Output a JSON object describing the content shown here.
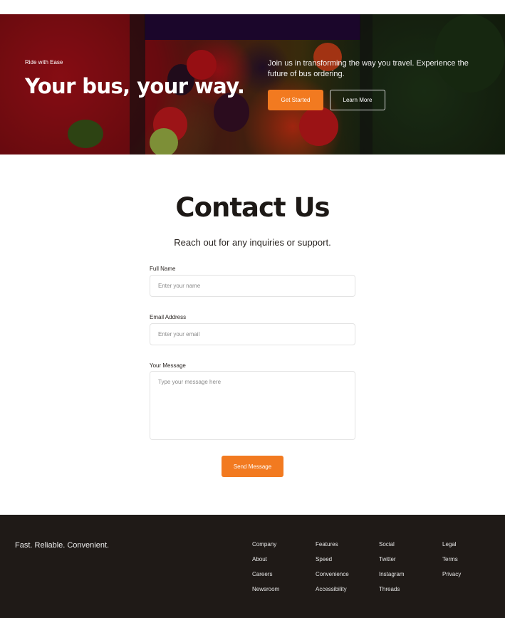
{
  "hero": {
    "eyebrow": "Ride with Ease",
    "title": "Your bus, your way.",
    "description": "Join us in transforming the way you travel. Experience the future of bus ordering.",
    "primary_button": "Get Started",
    "secondary_button": "Learn More"
  },
  "contact": {
    "title": "Contact Us",
    "subtitle": "Reach out for any inquiries or support.",
    "name_label": "Full Name",
    "name_placeholder": "Enter your name",
    "email_label": "Email Address",
    "email_placeholder": "Enter your email",
    "message_label": "Your Message",
    "message_placeholder": "Type your message here",
    "submit_label": "Send Message"
  },
  "footer": {
    "tagline": "Fast. Reliable. Convenient.",
    "columns": [
      {
        "links": [
          "Company",
          "About",
          "Careers",
          "Newsroom"
        ]
      },
      {
        "links": [
          "Features",
          "Speed",
          "Convenience",
          "Accessibility"
        ]
      },
      {
        "links": [
          "Social",
          "Twitter",
          "Instagram",
          "Threads"
        ]
      },
      {
        "links": [
          "Legal",
          "Terms",
          "Privacy"
        ]
      }
    ]
  },
  "colors": {
    "accent": "#f27a20",
    "footer_bg": "#1f1a17",
    "text_dark": "#1d1916"
  }
}
